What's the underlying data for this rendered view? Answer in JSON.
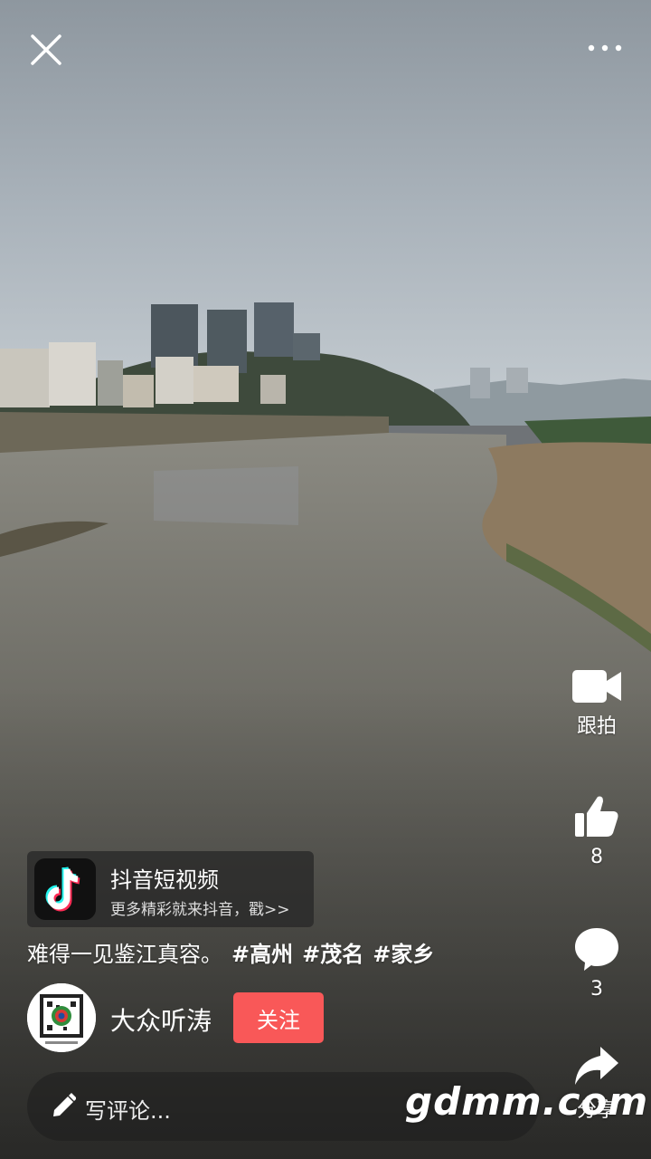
{
  "toolbar": {
    "close_icon": "close-icon",
    "more_icon": "more-dots-icon"
  },
  "rail": {
    "duet_label": "跟拍",
    "likes": "8",
    "comments": "3",
    "share_label": "分享"
  },
  "promo": {
    "title": "抖音短视频",
    "subtitle": "更多精彩就来抖音，戳>>"
  },
  "caption": {
    "text": "难得一见鉴江真容。",
    "tags": [
      "#高州",
      "#茂名",
      "#家乡"
    ]
  },
  "author": {
    "name": "大众听涛",
    "follow_label": "关注"
  },
  "comment": {
    "placeholder": "写评论..."
  },
  "watermark": "gdmm.com",
  "colors": {
    "follow": "#f95858",
    "sky": "#a9b3bb",
    "water": "#6b6a63"
  }
}
